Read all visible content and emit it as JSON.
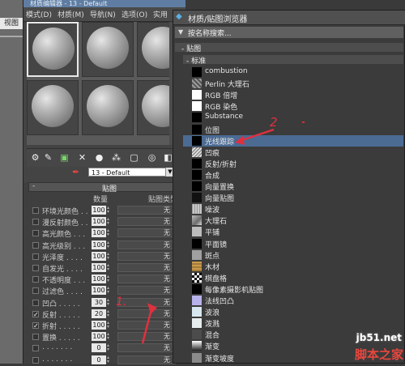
{
  "viewport": {
    "tab_label": "视图"
  },
  "material_editor": {
    "title": "材质编辑器 - 13 - Default",
    "menu": [
      "模式(D)",
      "材质(M)",
      "导航(N)",
      "选项(O)",
      "实用"
    ],
    "material_name": "13 - Default",
    "maps_rollout": {
      "title": "贴图",
      "columns": {
        "amount": "数量",
        "map": "贴图类型"
      },
      "rows": [
        {
          "label": "环境光颜色 . .",
          "amount": "100",
          "map": "无",
          "checked": false
        },
        {
          "label": "漫反射颜色 . .",
          "amount": "100",
          "map": "无",
          "checked": false
        },
        {
          "label": "高光颜色 . . .",
          "amount": "100",
          "map": "无",
          "checked": false
        },
        {
          "label": "高光级别 . . .",
          "amount": "100",
          "map": "无",
          "checked": false
        },
        {
          "label": "光泽度 . . . .",
          "amount": "100",
          "map": "无",
          "checked": false
        },
        {
          "label": "自发光 . . . .",
          "amount": "100",
          "map": "无",
          "checked": false
        },
        {
          "label": "不透明度 . . .",
          "amount": "100",
          "map": "无",
          "checked": false
        },
        {
          "label": "过滤色 . . . .",
          "amount": "100",
          "map": "无",
          "checked": false
        },
        {
          "label": "凹凸 . . . . .",
          "amount": "30",
          "map": "无",
          "checked": false
        },
        {
          "label": "反射 . . . . .",
          "amount": "20",
          "map": "无",
          "checked": true
        },
        {
          "label": "折射 . . . . .",
          "amount": "100",
          "map": "无",
          "checked": true
        },
        {
          "label": "置换 . . . . .",
          "amount": "100",
          "map": "无",
          "checked": false
        },
        {
          "label": ". . . . . . .",
          "amount": "0",
          "map": "无",
          "checked": false
        },
        {
          "label": ". . . . . . .",
          "amount": "0",
          "map": "无",
          "checked": false
        }
      ]
    }
  },
  "browser": {
    "title": "材质/贴图浏览器",
    "search_placeholder": "按名称搜索...",
    "group_label": "- 贴图",
    "subgroup_label": "- 标准",
    "items": [
      {
        "name": "combustion",
        "swatch": "black"
      },
      {
        "name": "Perlin 大理石",
        "swatch": "perlin"
      },
      {
        "name": "RGB 倍增",
        "swatch": "white"
      },
      {
        "name": "RGB 染色",
        "swatch": "white"
      },
      {
        "name": "Substance",
        "swatch": "black"
      },
      {
        "name": "位图",
        "swatch": "black"
      },
      {
        "name": "光线跟踪",
        "swatch": "black",
        "selected": true
      },
      {
        "name": "凹痕",
        "swatch": "bump"
      },
      {
        "name": "反射/折射",
        "swatch": "black"
      },
      {
        "name": "合成",
        "swatch": "black"
      },
      {
        "name": "向量置换",
        "swatch": "black"
      },
      {
        "name": "向量贴图",
        "swatch": "vec"
      },
      {
        "name": "噪波",
        "swatch": "noise"
      },
      {
        "name": "大理石",
        "swatch": "marble"
      },
      {
        "name": "平铺",
        "swatch": "tile"
      },
      {
        "name": "平面镜",
        "swatch": "black"
      },
      {
        "name": "斑点",
        "swatch": "speckle"
      },
      {
        "name": "木材",
        "swatch": "wood"
      },
      {
        "name": "棋盘格",
        "swatch": "checker"
      },
      {
        "name": "每像素摄影机贴图",
        "swatch": "black"
      },
      {
        "name": "法线凹凸",
        "swatch": "normal"
      },
      {
        "name": "波浪",
        "swatch": "waves"
      },
      {
        "name": "泼溅",
        "swatch": "splat"
      },
      {
        "name": "混合",
        "swatch": "mix"
      },
      {
        "name": "渐变",
        "swatch": "grad"
      },
      {
        "name": "渐变坡度",
        "swatch": "gray"
      }
    ]
  },
  "annotations": {
    "one": "1.",
    "two": "2"
  },
  "watermark": {
    "url": "jb51.net",
    "cn": "脚本之家"
  },
  "colors": {
    "selected_row": "#4b6b93",
    "title_bar": "#5f7da2",
    "annotation": "#e0303e"
  }
}
